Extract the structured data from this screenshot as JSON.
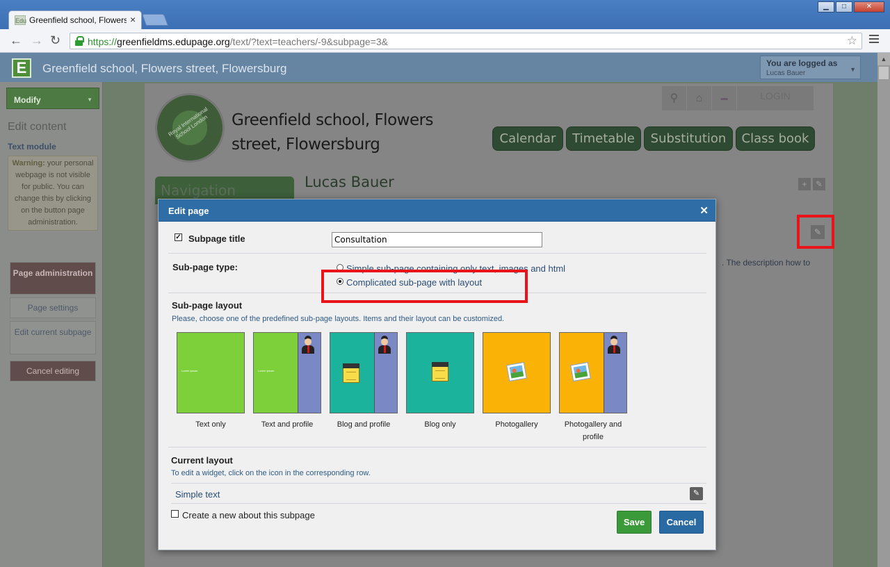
{
  "browser": {
    "tab_title": "Greenfield school, Flowers st",
    "favicon_text": "Edu",
    "url_scheme": "https://",
    "url_host": "greenfieldms.edupage.org",
    "url_path": "/text/?text=teachers/-9&subpage=3&"
  },
  "header": {
    "title": "Greenfield school, Flowers street, Flowersburg",
    "logo_letter": "E",
    "logged_label": "You are logged as",
    "logged_user": "Lucas Bauer"
  },
  "sidebar": {
    "modify_label": "Modify",
    "edit_content": "Edit content",
    "text_module": "Text module",
    "warning_label": "Warning:",
    "warning_text": "your personal webpage is not visible for public. You can change this by clicking on the button page administration.",
    "page_administration": "Page administration",
    "page_settings": "Page settings",
    "edit_current_subpage": "Edit current subpage",
    "cancel_editing": "Cancel editing"
  },
  "site": {
    "school_name": "Greenfield school, Flowers street, Flowersburg",
    "logo_text": "Royal International School London",
    "login": "LOGIN",
    "menu": [
      "Calendar",
      "Timetable",
      "Substitution",
      "Class book"
    ],
    "navigation": "Navigation",
    "person_name": "Lucas Bauer",
    "description_fragment": ". The description how to"
  },
  "modal": {
    "title": "Edit page",
    "subpage_title_label": "Subpage title",
    "subpage_title_value": "Consultation",
    "type_label": "Sub-page type:",
    "type_option_simple": "Simple sub-page containing only text, images and html",
    "type_option_complicated": "Complicated sub-page with layout",
    "layout_label": "Sub-page layout",
    "layout_help": "Please, choose one of the predefined sub-page layouts. Items and their layout can be customized.",
    "layouts": [
      {
        "label": "Text only"
      },
      {
        "label": "Text and profile"
      },
      {
        "label": "Blog and profile"
      },
      {
        "label": "Blog only"
      },
      {
        "label": "Photogallery"
      },
      {
        "label": "Photogallery and profile"
      }
    ],
    "tile_text": "Lorem Ipsum",
    "current_layout_label": "Current layout",
    "current_layout_help": "To edit a widget, click on the icon in the corresponding row.",
    "widget_name": "Simple text",
    "create_about_label": "Create a new about this subpage",
    "save": "Save",
    "cancel": "Cancel"
  },
  "colors": {
    "modal_header": "#2e6da6",
    "highlight": "#e8141a",
    "tile_green": "#7dd03a",
    "tile_teal": "#1cb39d",
    "tile_orange": "#fbb206",
    "tile_blue": "#7a89c6"
  }
}
